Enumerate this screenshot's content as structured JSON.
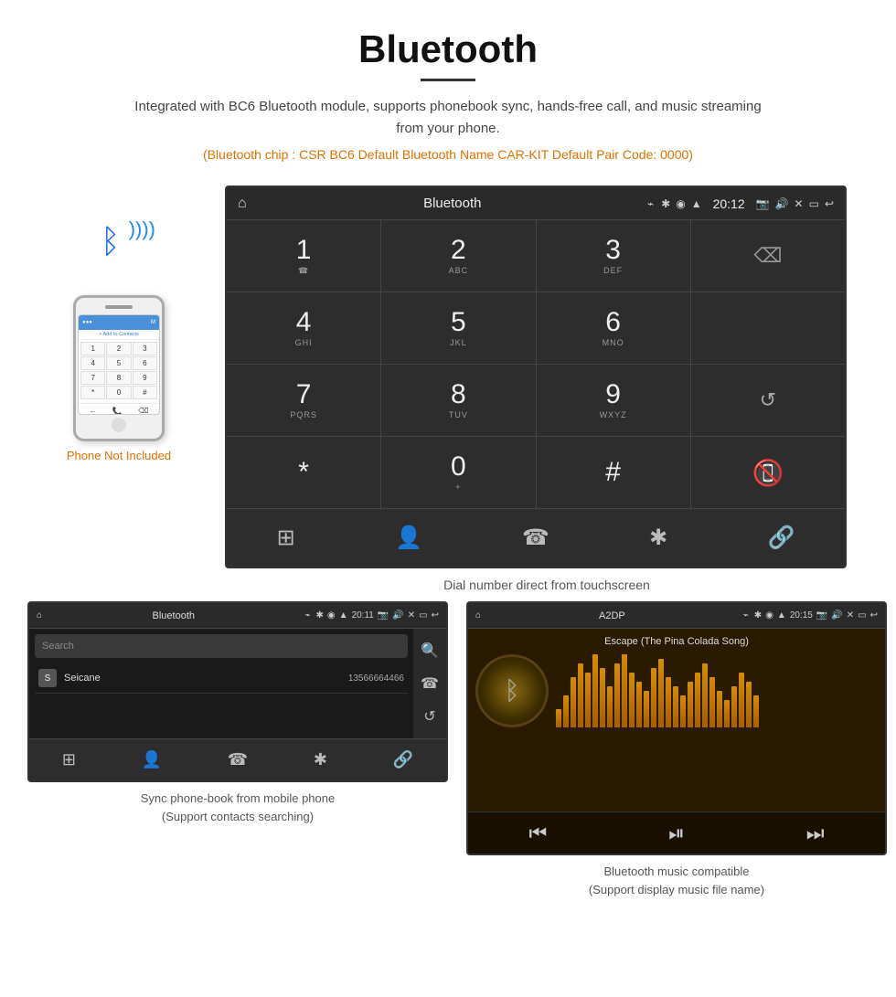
{
  "header": {
    "title": "Bluetooth",
    "subtitle": "Integrated with BC6 Bluetooth module, supports phonebook sync, hands-free call, and music streaming from your phone.",
    "spec_line": "(Bluetooth chip : CSR BC6    Default Bluetooth Name CAR-KIT    Default Pair Code: 0000)"
  },
  "phone_section": {
    "not_included_label": "Phone Not Included"
  },
  "car_screen": {
    "status_bar": {
      "title": "Bluetooth",
      "time": "20:12",
      "usb_icon": "⌁"
    },
    "dialpad": [
      {
        "main": "1",
        "sub": "☎"
      },
      {
        "main": "2",
        "sub": "ABC"
      },
      {
        "main": "3",
        "sub": "DEF"
      },
      {
        "main": "⌫",
        "sub": ""
      },
      {
        "main": "4",
        "sub": "GHI"
      },
      {
        "main": "5",
        "sub": "JKL"
      },
      {
        "main": "6",
        "sub": "MNO"
      },
      {
        "main": "",
        "sub": ""
      },
      {
        "main": "7",
        "sub": "PQRS"
      },
      {
        "main": "8",
        "sub": "TUV"
      },
      {
        "main": "9",
        "sub": "WXYZ"
      },
      {
        "main": "↺",
        "sub": ""
      },
      {
        "main": "*",
        "sub": ""
      },
      {
        "main": "0",
        "sub": "+"
      },
      {
        "main": "#",
        "sub": ""
      },
      {
        "main": "call_end",
        "sub": ""
      }
    ],
    "bottom_nav": [
      "⊞",
      "👤",
      "☎",
      "✱",
      "🔗"
    ]
  },
  "caption_center": "Dial number direct from touchscreen",
  "phonebook_screen": {
    "status_bar": {
      "title": "Bluetooth",
      "time": "20:11"
    },
    "search_placeholder": "Search",
    "contacts": [
      {
        "initial": "S",
        "name": "Seicane",
        "number": "13566664466"
      }
    ],
    "right_nav_icons": [
      "🔍",
      "☎",
      "↺"
    ],
    "bottom_nav": [
      "⊞",
      "👤",
      "☎",
      "✱",
      "🔗"
    ]
  },
  "music_screen": {
    "status_bar": {
      "title": "A2DP",
      "time": "20:15"
    },
    "song_title": "Escape (The Pina Colada Song)",
    "eq_bars": [
      20,
      35,
      55,
      70,
      60,
      80,
      65,
      45,
      70,
      85,
      60,
      50,
      40,
      65,
      75,
      55,
      45,
      35,
      50,
      60,
      70,
      55,
      40,
      30,
      45,
      60,
      50,
      35
    ],
    "controls": [
      "⏮",
      "⏯",
      "⏭"
    ]
  },
  "captions": {
    "phonebook": "Sync phone-book from mobile phone\n(Support contacts searching)",
    "music": "Bluetooth music compatible\n(Support display music file name)"
  }
}
